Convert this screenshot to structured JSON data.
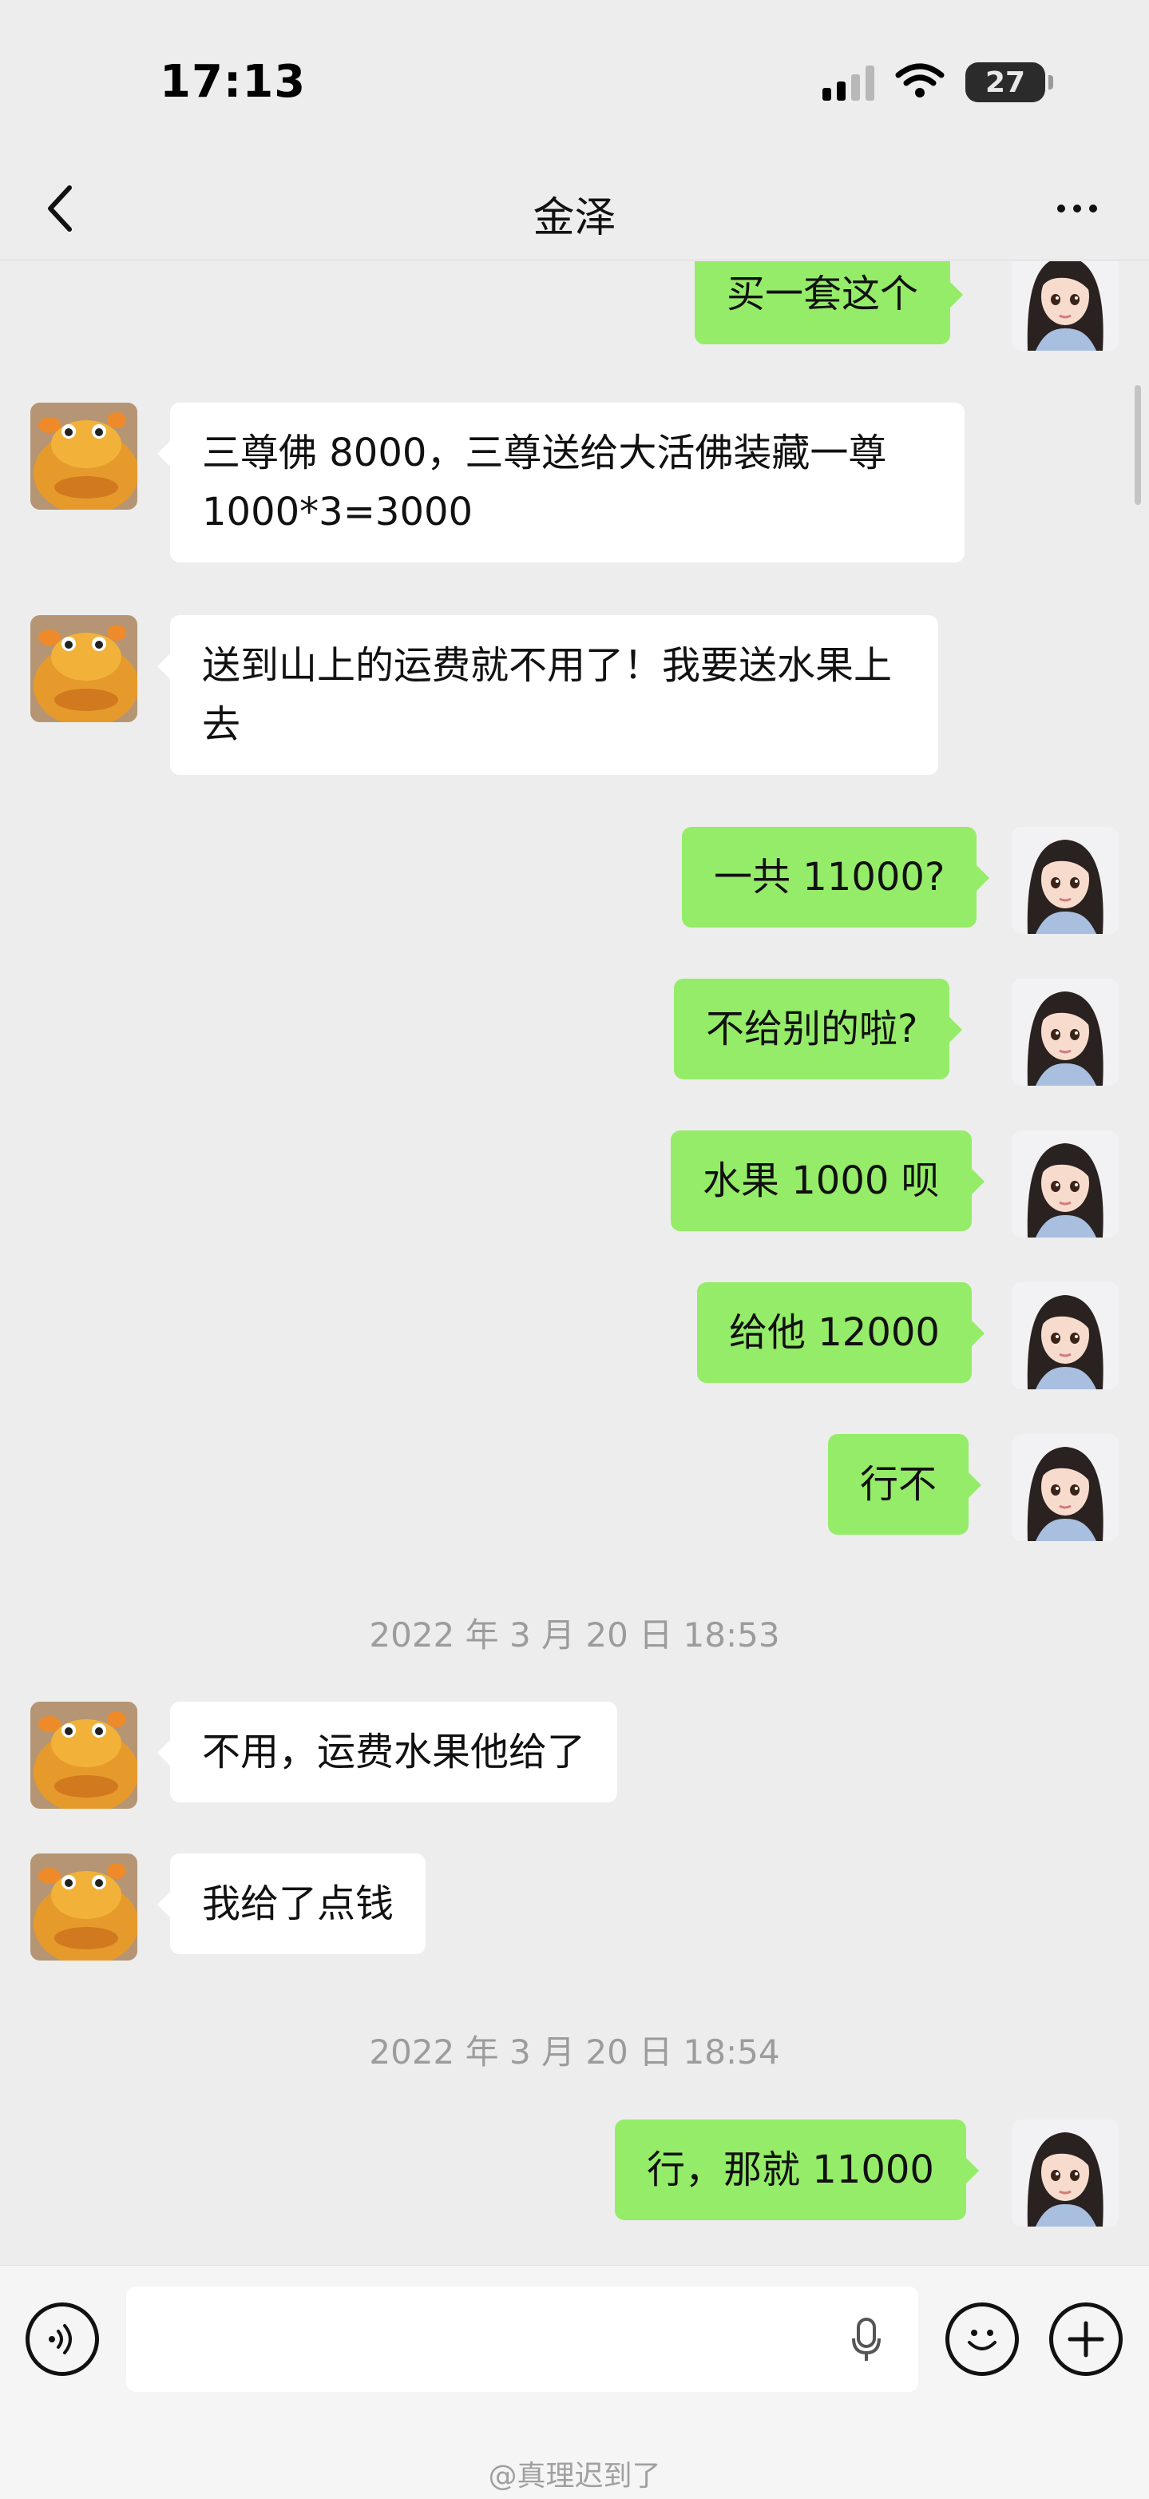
{
  "status_bar": {
    "time": "17:13",
    "battery": "27"
  },
  "nav": {
    "title": "金泽"
  },
  "messages": [
    {
      "side": "out",
      "text": "买一套这个"
    },
    {
      "side": "in",
      "text": "三尊佛 8000，三尊送给大活佛装藏一尊 1000*3=3000"
    },
    {
      "side": "in",
      "text": "送到山上的运费就不用了！我要送水果上去"
    },
    {
      "side": "out",
      "text": "一共 11000?"
    },
    {
      "side": "out",
      "text": "不给别的啦?"
    },
    {
      "side": "out",
      "text": "水果 1000 呗"
    },
    {
      "side": "out",
      "text": "给他 12000"
    },
    {
      "side": "out",
      "text": "行不"
    },
    {
      "type": "timestamp",
      "text": "2022 年 3 月 20 日 18:53"
    },
    {
      "side": "in",
      "text": "不用，运费水果他给了"
    },
    {
      "side": "in",
      "text": "我给了点钱"
    },
    {
      "type": "timestamp",
      "text": "2022 年 3 月 20 日 18:54"
    },
    {
      "side": "out",
      "text": "行，那就 11000"
    }
  ],
  "input_bar": {
    "placeholder": ""
  },
  "watermark": "@真理迟到了",
  "colors": {
    "background": "#ededed",
    "sent_bubble": "#95ec69",
    "received_bubble": "#ffffff",
    "timestamp": "#9c9c9c"
  },
  "icons": {
    "back": "chevron-left-icon",
    "more": "ellipsis-icon",
    "voice": "voice-icon",
    "mic": "microphone-icon",
    "emoji": "emoji-icon",
    "add": "plus-icon"
  }
}
